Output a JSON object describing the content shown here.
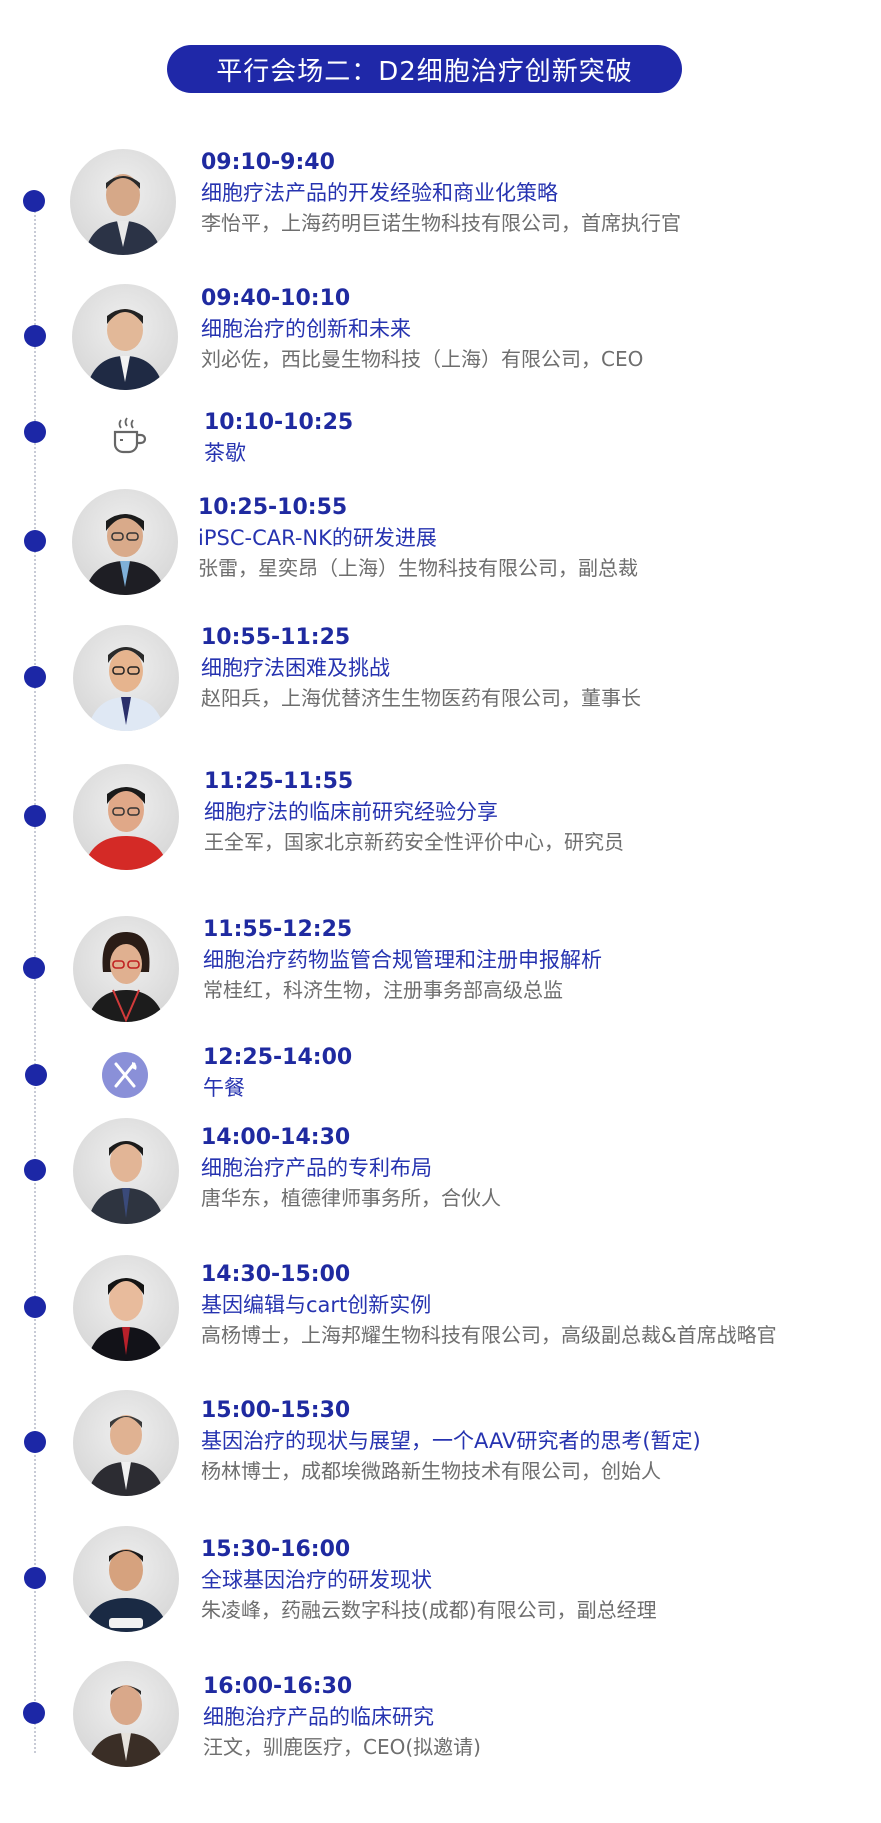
{
  "header": {
    "title": "平行会场二：D2细胞治疗创新突破"
  },
  "colors": {
    "accent": "#1f28a8",
    "dot": "#1c27a6",
    "topic": "#2633b0",
    "speaker": "#6e6e6e"
  },
  "sessions": [
    {
      "time": "09:10-9:40",
      "topic": "细胞疗法产品的开发经验和商业化策略",
      "speaker": "李怡平，上海药明巨诺生物科技有限公司，首席执行官"
    },
    {
      "time": "09:40-10:10",
      "topic": "细胞治疗的创新和未来",
      "speaker": "刘必佐，西比曼生物科技（上海）有限公司，CEO"
    },
    {
      "time": "10:10-10:25",
      "topic": "茶歇",
      "icon": "coffee-cup-icon"
    },
    {
      "time": "10:25-10:55",
      "topic": "iPSC-CAR-NK的研发进展",
      "speaker": "张雷，星奕昂（上海）生物科技有限公司，副总裁"
    },
    {
      "time": "10:55-11:25",
      "topic": "细胞疗法困难及挑战",
      "speaker": "赵阳兵，上海优替济生生物医药有限公司，董事长"
    },
    {
      "time": "11:25-11:55",
      "topic": "细胞疗法的临床前研究经验分享",
      "speaker": "王全军，国家北京新药安全性评价中心，研究员"
    },
    {
      "time": "11:55-12:25",
      "topic": "细胞治疗药物监管合规管理和注册申报解析",
      "speaker": "常桂红，科济生物，注册事务部高级总监"
    },
    {
      "time": "12:25-14:00",
      "topic": "午餐",
      "icon": "fork-knife-icon"
    },
    {
      "time": "14:00-14:30",
      "topic": "细胞治疗产品的专利布局",
      "speaker": "唐华东，植德律师事务所，合伙人"
    },
    {
      "time": "14:30-15:00",
      "topic": "基因编辑与cart创新实例",
      "speaker": "高杨博士，上海邦耀生物科技有限公司，高级副总裁&首席战略官"
    },
    {
      "time": "15:00-15:30",
      "topic": "基因治疗的现状与展望，一个AAV研究者的思考(暂定)",
      "speaker": "杨林博士，成都埃微路新生物技术有限公司，创始人"
    },
    {
      "time": "15:30-16:00",
      "topic": "全球基因治疗的研发现状",
      "speaker": "朱凌峰，药融云数字科技(成都)有限公司，副总经理"
    },
    {
      "time": "16:00-16:30",
      "topic": "细胞治疗产品的临床研究",
      "speaker": "汪文，驯鹿医疗，CEO(拟邀请)"
    }
  ]
}
